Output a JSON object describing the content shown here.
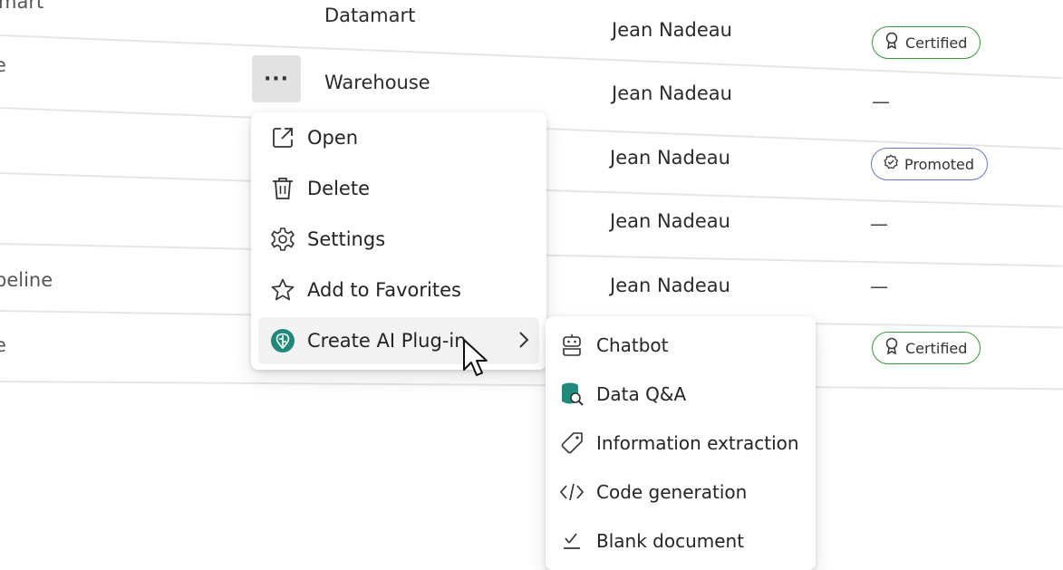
{
  "table": {
    "rows": [
      {
        "left_label": "mart",
        "name": "Datamart",
        "owner": "Jean Nadeau",
        "endorsement": "Certified"
      },
      {
        "left_label": "e",
        "name": "Warehouse",
        "owner": "Jean Nadeau",
        "endorsement": "—"
      },
      {
        "left_label": "",
        "name": "",
        "owner": "Jean Nadeau",
        "endorsement": "Promoted"
      },
      {
        "left_label": "",
        "name": "",
        "owner": "Jean Nadeau",
        "endorsement": "—"
      },
      {
        "left_label": "peline",
        "name": "",
        "owner": "Jean Nadeau",
        "endorsement": "—"
      },
      {
        "left_label": "e",
        "name": "",
        "owner": "",
        "endorsement": "Certified"
      }
    ]
  },
  "more_button": {
    "label": "···"
  },
  "context_menu": {
    "items": [
      {
        "label": "Open",
        "icon": "open-external-icon"
      },
      {
        "label": "Delete",
        "icon": "trash-icon"
      },
      {
        "label": "Settings",
        "icon": "gear-icon"
      },
      {
        "label": "Add to Favorites",
        "icon": "star-icon"
      },
      {
        "label": "Create AI Plug-in",
        "icon": "ai-plugin-icon",
        "has_submenu": true
      }
    ]
  },
  "submenu": {
    "items": [
      {
        "label": "Chatbot",
        "icon": "bot-icon"
      },
      {
        "label": "Data Q&A",
        "icon": "database-search-icon"
      },
      {
        "label": "Information extraction",
        "icon": "tag-icon"
      },
      {
        "label": "Code generation",
        "icon": "code-icon"
      },
      {
        "label": "Blank document",
        "icon": "blank-document-icon"
      }
    ]
  },
  "colors": {
    "certified_border": "#3a9a3a",
    "promoted_border": "#6a78c8",
    "ai_icon": "#1f8a7a"
  }
}
